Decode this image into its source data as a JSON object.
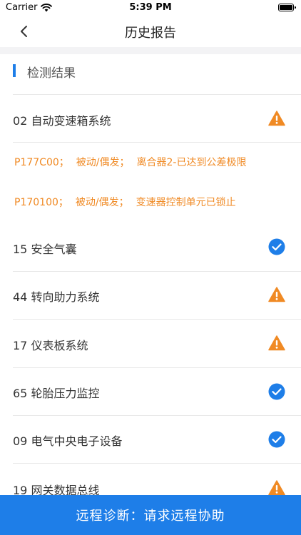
{
  "status_bar": {
    "carrier": "Carrier",
    "time": "5:39 PM"
  },
  "nav": {
    "title": "历史报告",
    "back_icon": "chevron-left-icon"
  },
  "section": {
    "title": "检测结果"
  },
  "systems": [
    {
      "label": "02 自动变速箱系统",
      "status": "warning",
      "icon": "warning-icon",
      "color": "#f08a24"
    },
    {
      "label": "15 安全气囊",
      "status": "ok",
      "icon": "check-circle-icon",
      "color": "#1e7ee8"
    },
    {
      "label": "44 转向助力系统",
      "status": "warning",
      "icon": "warning-icon",
      "color": "#f08a24"
    },
    {
      "label": "17 仪表板系统",
      "status": "warning",
      "icon": "warning-icon",
      "color": "#f08a24"
    },
    {
      "label": "65 轮胎压力监控",
      "status": "ok",
      "icon": "check-circle-icon",
      "color": "#1e7ee8"
    },
    {
      "label": "09 电气中央电子设备",
      "status": "ok",
      "icon": "check-circle-icon",
      "color": "#1e7ee8"
    },
    {
      "label": "19 网关数据总线",
      "status": "warning",
      "icon": "warning-icon",
      "color": "#f08a24"
    }
  ],
  "faults": [
    {
      "code": "P177C00；",
      "type": "被动/偶发；",
      "desc": "离合器2-已达到公差极限"
    },
    {
      "code": "P170100；",
      "type": "被动/偶发；",
      "desc": "变速器控制单元已锁止"
    }
  ],
  "bottom_button": {
    "label": "远程诊断：请求远程协助"
  },
  "colors": {
    "accent": "#1e7ee8",
    "warning": "#f08a24"
  }
}
